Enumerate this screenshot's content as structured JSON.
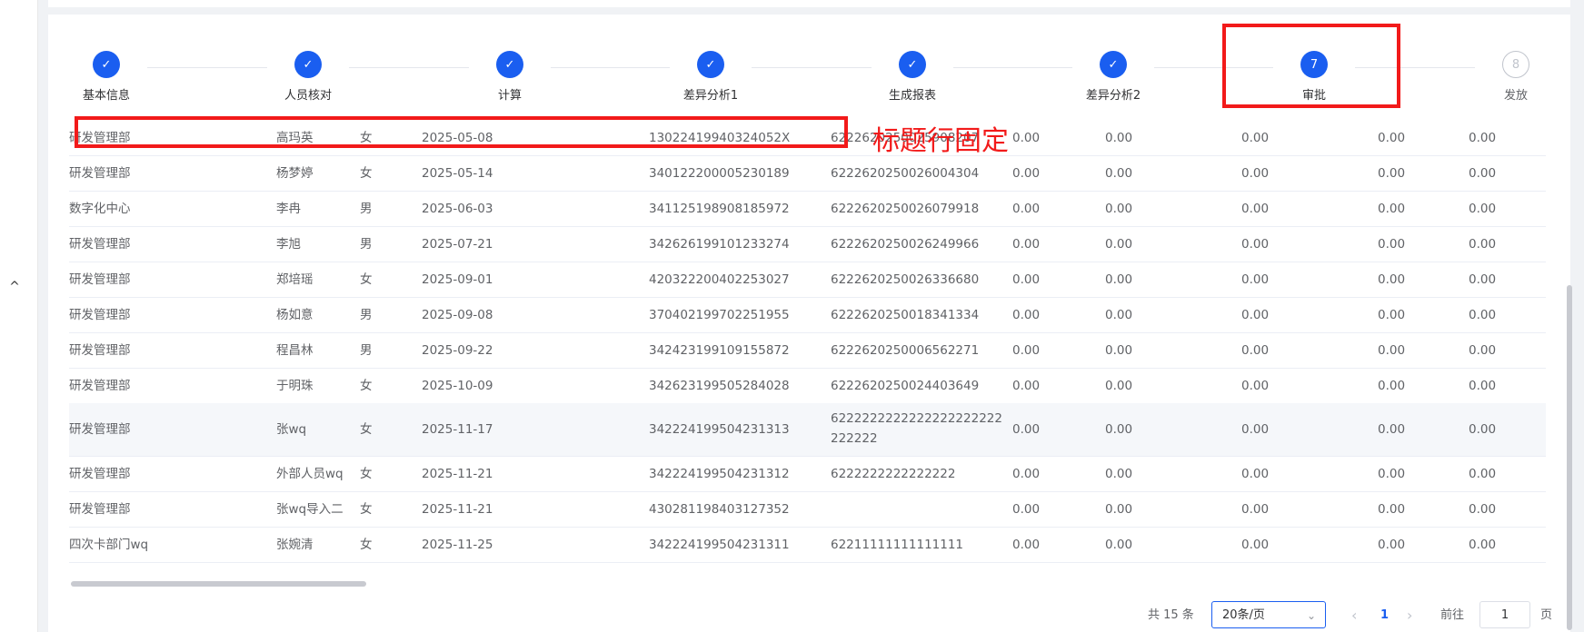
{
  "steps": [
    {
      "label": "基本信息",
      "state": "done",
      "number": ""
    },
    {
      "label": "人员核对",
      "state": "done",
      "number": ""
    },
    {
      "label": "计算",
      "state": "done",
      "number": ""
    },
    {
      "label": "差异分析1",
      "state": "done",
      "number": ""
    },
    {
      "label": "生成报表",
      "state": "done",
      "number": ""
    },
    {
      "label": "差异分析2",
      "state": "done",
      "number": ""
    },
    {
      "label": "审批",
      "state": "active",
      "number": "7"
    },
    {
      "label": "发放",
      "state": "pending",
      "number": "8"
    }
  ],
  "check_glyph": "✓",
  "table": {
    "rows": [
      [
        "研发管理部",
        "高玛英",
        "女",
        "2025-05-08",
        "130224199403240​52X",
        "6222620250025908207",
        "0.00",
        "0.00",
        "0.00",
        "0.00",
        "0.00"
      ],
      [
        "研发管理部",
        "杨梦婷",
        "女",
        "2025-05-14",
        "340122200005230189",
        "6222620250026004304",
        "0.00",
        "0.00",
        "0.00",
        "0.00",
        "0.00"
      ],
      [
        "数字化中心",
        "李冉",
        "男",
        "2025-06-03",
        "341125198908185972",
        "6222620250026079918",
        "0.00",
        "0.00",
        "0.00",
        "0.00",
        "0.00"
      ],
      [
        "研发管理部",
        "李旭",
        "男",
        "2025-07-21",
        "342626199101233274",
        "6222620250026249966",
        "0.00",
        "0.00",
        "0.00",
        "0.00",
        "0.00"
      ],
      [
        "研发管理部",
        "郑培瑶",
        "女",
        "2025-09-01",
        "420322200402253027",
        "6222620250026336680",
        "0.00",
        "0.00",
        "0.00",
        "0.00",
        "0.00"
      ],
      [
        "研发管理部",
        "杨如意",
        "男",
        "2025-09-08",
        "370402199702251955",
        "6222620250018341334",
        "0.00",
        "0.00",
        "0.00",
        "0.00",
        "0.00"
      ],
      [
        "研发管理部",
        "程昌林",
        "男",
        "2025-09-22",
        "342423199109155872",
        "6222620250006562271",
        "0.00",
        "0.00",
        "0.00",
        "0.00",
        "0.00"
      ],
      [
        "研发管理部",
        "于明珠",
        "女",
        "2025-10-09",
        "342623199505284028",
        "6222620250024403649",
        "0.00",
        "0.00",
        "0.00",
        "0.00",
        "0.00"
      ],
      [
        "研发管理部",
        "张wq",
        "女",
        "2025-11-17",
        "342224199504231313",
        "6222222222222222222222222222",
        "0.00",
        "0.00",
        "0.00",
        "0.00",
        "0.00"
      ],
      [
        "研发管理部",
        "外部人员wq",
        "女",
        "2025-11-21",
        "342224199504231312",
        "6222222222222222",
        "0.00",
        "0.00",
        "0.00",
        "0.00",
        "0.00"
      ],
      [
        "研发管理部",
        "张wq导入二",
        "女",
        "2025-11-21",
        "430281198403127352",
        "",
        "0.00",
        "0.00",
        "0.00",
        "0.00",
        "0.00"
      ],
      [
        "四次卡部门wq",
        "张婉清",
        "女",
        "2025-11-25",
        "342224199504231311",
        "62211111111111111",
        "0.00",
        "0.00",
        "0.00",
        "0.00",
        "0.00"
      ]
    ],
    "wrapped_card_lines": [
      "6222222222222222222222",
      "222222"
    ]
  },
  "pagination": {
    "total": "共 15 条",
    "page_size": "20条/页",
    "prev": "‹",
    "current": "1",
    "next": "›",
    "goto_label": "前往",
    "goto_value": "1",
    "unit": "页"
  },
  "caret": "^",
  "annotation": {
    "text": "标题行固定",
    "color": "#f21a1a"
  },
  "colors": {
    "primary": "#1a5ef0",
    "text": "#606266",
    "border": "#ebeef5"
  }
}
